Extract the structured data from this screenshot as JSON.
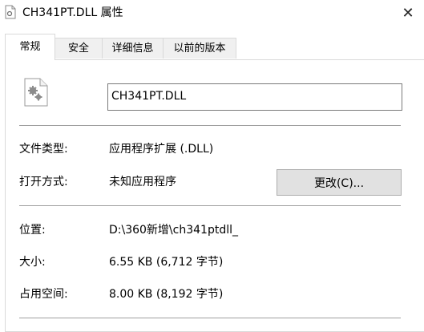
{
  "window": {
    "title": "CH341PT.DLL 属性",
    "close_glyph": "✕"
  },
  "tabs": [
    {
      "label": "常规",
      "active": true
    },
    {
      "label": "安全"
    },
    {
      "label": "详细信息"
    },
    {
      "label": "以前的版本"
    }
  ],
  "general": {
    "file_name": "CH341PT.DLL",
    "type_label": "文件类型:",
    "type_value": "应用程序扩展 (.DLL)",
    "open_with_label": "打开方式:",
    "open_with_value": "未知应用程序",
    "change_button": "更改(C)...",
    "location_label": "位置:",
    "location_value": "D:\\360新增\\ch341ptdll_",
    "size_label": "大小:",
    "size_value": "6.55 KB (6,712 字节)",
    "disk_size_label": "占用空间:",
    "disk_size_value": "8.00 KB (8,192 字节)"
  },
  "icons": {
    "title_icon": "dll-file-icon",
    "file_icon": "dll-gear-file-icon"
  }
}
